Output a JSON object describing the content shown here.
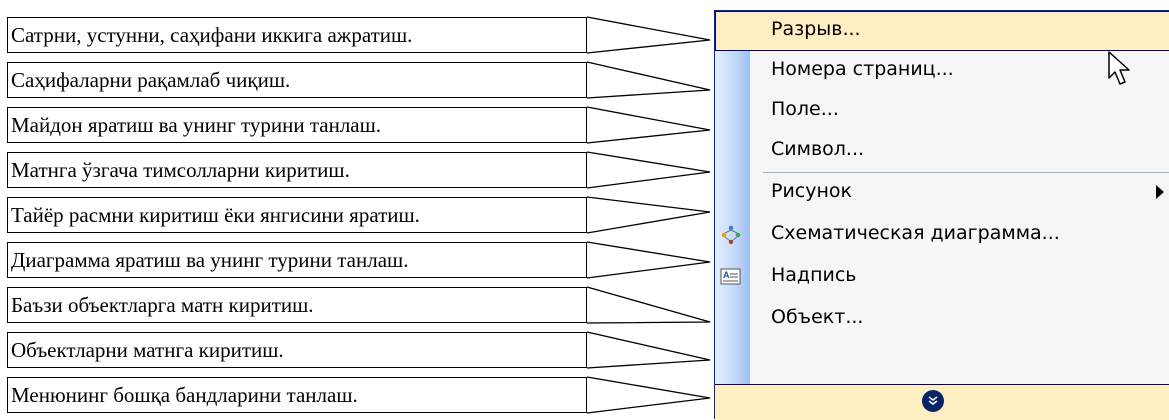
{
  "callouts": [
    "Сатрни, устунни, саҳифани иккига ажратиш.",
    "Саҳифаларни рақамлаб чиқиш.",
    "Майдон яратиш ва унинг турини танлаш.",
    "Матнга ўзгача тимсолларни киритиш.",
    "Тайёр расмни киритиш ёки янгисини яратиш.",
    "Диаграмма яратиш ва унинг турини танлаш.",
    "Баъзи объектларга матн киритиш.",
    "Объектларни матнга киритиш.",
    "Менюнинг бошқа бандларини танлаш."
  ],
  "menu": {
    "items": [
      {
        "label": "Разрыв...",
        "hover": true
      },
      {
        "label": "Номера страниц..."
      },
      {
        "label": "Поле..."
      },
      {
        "label": "Символ..."
      },
      {
        "label": "Рисунок",
        "submenu": true
      },
      {
        "label": "Схематическая диаграмма...",
        "icon": "diagram-icon"
      },
      {
        "label": "Надпись",
        "icon": "text-box-icon"
      },
      {
        "label": "Объект..."
      }
    ],
    "more_icon": "expand-chevrons-icon"
  },
  "colors": {
    "menu_bg": "#f6f6f6",
    "highlight": "#ffeec2",
    "highlight_border": "#000080",
    "gutter": "#c4daf9"
  }
}
